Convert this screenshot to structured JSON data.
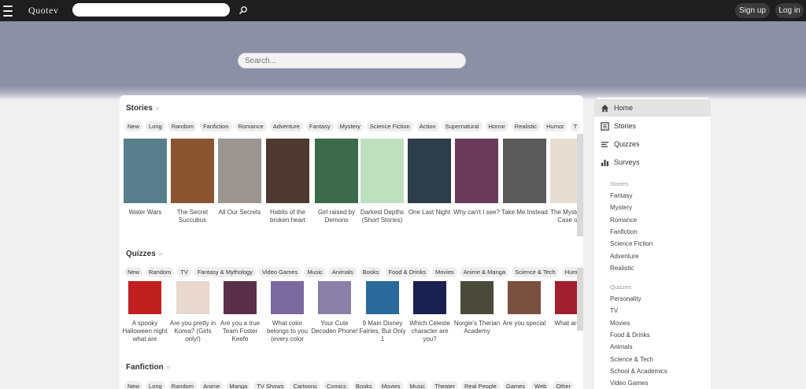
{
  "topbar": {
    "logo": "Quotev",
    "signup_label": "Sign up",
    "login_label": "Log in",
    "search_value": ""
  },
  "hero": {
    "search_placeholder": "Search..."
  },
  "stories": {
    "title": "Stories",
    "arrow": "»",
    "tags": [
      "New",
      "Long",
      "Random",
      "Fanfiction",
      "Romance",
      "Adventure",
      "Fantasy",
      "Mystery",
      "Science Fiction",
      "Action",
      "Supernatural",
      "Horror",
      "Realistic",
      "Humor",
      "T"
    ],
    "items": [
      {
        "title": "Water Wars",
        "color": "#5a7f8c"
      },
      {
        "title": "The Secret Succubus",
        "color": "#8a5530"
      },
      {
        "title": "All Our Secrets",
        "color": "#9a9590"
      },
      {
        "title": "Habits of the broken heart",
        "color": "#4e3a30"
      },
      {
        "title": "Girl raised by Demons",
        "color": "#3d6a4a"
      },
      {
        "title": "Darkest Depths (Short Stories)",
        "color": "#bfe0bf"
      },
      {
        "title": "One Last Night",
        "color": "#2d3d4a"
      },
      {
        "title": "Why can't I see?",
        "color": "#6a3a5a"
      },
      {
        "title": "Take Me Instead",
        "color": "#5a5a5a"
      },
      {
        "title": "The Mysterious Case of th",
        "color": "#e6ddd0"
      }
    ]
  },
  "quizzes": {
    "title": "Quizzes",
    "arrow": "»",
    "tags": [
      "New",
      "Random",
      "TV",
      "Fantasy & Mythology",
      "Video Games",
      "Music",
      "Animals",
      "Books",
      "Food & Drinks",
      "Movies",
      "Anime & Manga",
      "Science & Tech",
      "Hum"
    ],
    "items": [
      {
        "title": "A spooky Halloween night what are",
        "color": "#c02020"
      },
      {
        "title": "Are you pretty in Korea? (Girls only!)",
        "color": "#e8d8d0"
      },
      {
        "title": "Are you a true Team Foster Keefe",
        "color": "#5a3048"
      },
      {
        "title": "What color belongs to you (every color",
        "color": "#7a6aa0"
      },
      {
        "title": "Your Cute Decoden Phone!",
        "color": "#8a80a8"
      },
      {
        "title": "9 Main Disney Fairies, But Only 1",
        "color": "#2a6a9a"
      },
      {
        "title": "Which Celeste character are you?",
        "color": "#1a2050"
      },
      {
        "title": "Norgie's Therian Academy",
        "color": "#4a4a3a"
      },
      {
        "title": "Are you special",
        "color": "#7a5040"
      },
      {
        "title": "What are yo",
        "color": "#a02030"
      }
    ]
  },
  "fanfiction": {
    "title": "Fanfiction",
    "arrow": "»",
    "tags": [
      "New",
      "Long",
      "Random",
      "Anime",
      "Manga",
      "TV Shows",
      "Cartoons",
      "Comics",
      "Books",
      "Movies",
      "Music",
      "Theater",
      "Real People",
      "Games",
      "Web",
      "Other"
    ]
  },
  "sidebar": {
    "nav": [
      {
        "label": "Home",
        "icon": "home-icon"
      },
      {
        "label": "Stories",
        "icon": "book-icon"
      },
      {
        "label": "Quizzes",
        "icon": "list-icon"
      },
      {
        "label": "Surveys",
        "icon": "bar-chart-icon"
      }
    ],
    "stories_head": "Stories",
    "stories_links": [
      "Fantasy",
      "Mystery",
      "Romance",
      "Fanfiction",
      "Science Fiction",
      "Adventure",
      "Realistic"
    ],
    "quizzes_head": "Quizzes",
    "quizzes_links": [
      "Personality",
      "TV",
      "Movies",
      "Food & Drinks",
      "Animals",
      "Science & Tech",
      "School & Academics",
      "Video Games"
    ]
  }
}
